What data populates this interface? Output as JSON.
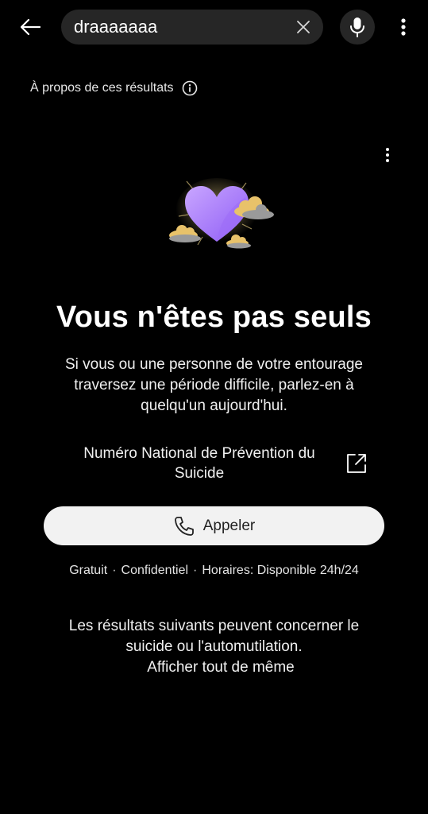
{
  "search": {
    "query": "draaaaaaa",
    "clear_icon": "close-icon",
    "mic_icon": "microphone-icon",
    "back_icon": "arrow-left-icon",
    "menu_icon": "more-vert-icon"
  },
  "about": {
    "label": "À propos de ces résultats",
    "icon": "info-icon"
  },
  "card": {
    "menu_icon": "more-vert-icon",
    "illustration": "heart-clouds-illustration",
    "title": "Vous n'êtes pas seuls",
    "body": "Si vous ou une personne de votre entourage traversez une période difficile, parlez-en à quelqu'un aujourd'hui.",
    "hotline_name": "Numéro National de Prévention du Suicide",
    "external_icon": "open-external-icon",
    "call_label": "Appeler",
    "call_icon": "phone-icon",
    "meta": [
      "Gratuit",
      "Confidentiel",
      "Horaires: Disponible 24h/24"
    ],
    "meta_separator": "·"
  },
  "warning": {
    "text": "Les résultats suivants peuvent concerner le suicide ou l'automutilation.",
    "show_anyway": "Afficher tout de même"
  },
  "colors": {
    "background": "#000000",
    "search_bg": "#262626",
    "heart": "#a77bff",
    "cloud_gold": "#e8c26a",
    "button_bg": "#f2f2f2"
  }
}
